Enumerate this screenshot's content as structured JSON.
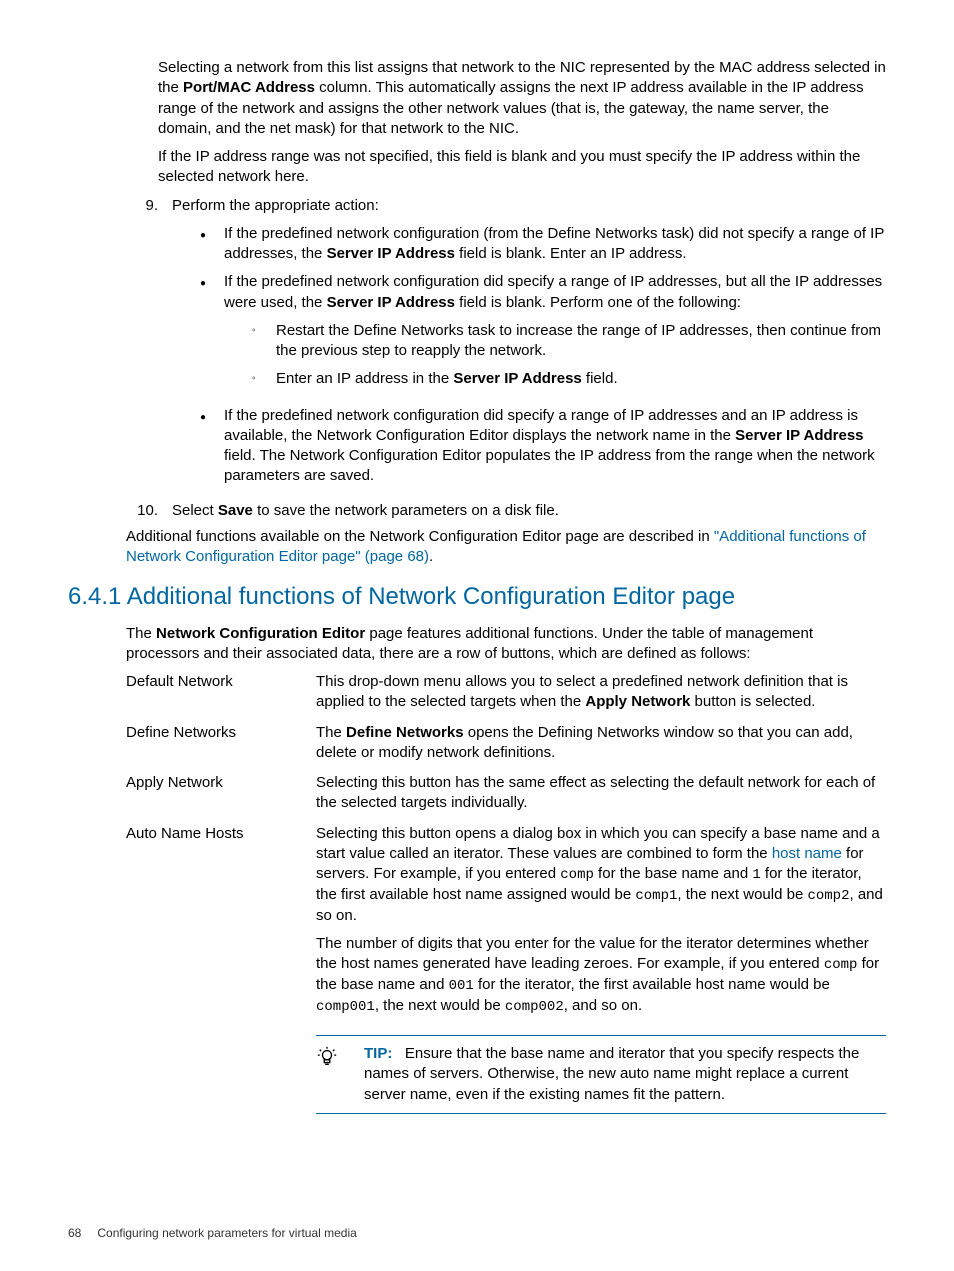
{
  "preamble": {
    "p1_a": "Selecting a network from this list assigns that network to the NIC represented by the MAC address selected in the ",
    "p1_bold": "Port/MAC Address",
    "p1_b": " column. This automatically assigns the next IP address available in the IP address range of the network and assigns the other network values (that is, the gateway, the name server, the domain, and the net mask) for that network to the NIC.",
    "p2": "If the IP address range was not specified, this field is blank and you must specify the IP address within the selected network here."
  },
  "step9": {
    "num": "9.",
    "text": "Perform the appropriate action:",
    "b1_a": "If the predefined network configuration (from the Define Networks task) did not specify a range of IP addresses, the ",
    "b1_bold": "Server IP Address",
    "b1_b": " field is blank. Enter an IP address.",
    "b2_a": "If the predefined network configuration did specify a range of IP addresses, but all the IP addresses were used, the ",
    "b2_bold": "Server IP Address",
    "b2_b": " field is blank. Perform one of the following:",
    "b2_s1": "Restart the Define Networks task to increase the range of IP addresses, then continue from the previous step to reapply the network.",
    "b2_s2_a": "Enter an IP address in the ",
    "b2_s2_bold": "Server IP Address",
    "b2_s2_b": " field.",
    "b3_a": "If the predefined network configuration did specify a range of IP addresses and an IP address is available, the Network Configuration Editor displays the network name in the ",
    "b3_bold": "Server IP Address",
    "b3_b": " field. The Network Configuration Editor populates the IP address from the range when the network parameters are saved."
  },
  "step10": {
    "num": "10.",
    "a": "Select ",
    "bold": "Save",
    "b": " to save the network parameters on a disk file."
  },
  "add_p_a": "Additional functions available on the Network Configuration Editor page are described in ",
  "add_link": "\"Additional functions of Network Configuration Editor page\" (page 68)",
  "add_p_b": ".",
  "section_title": "6.4.1 Additional functions of Network Configuration Editor page",
  "intro_a": "The ",
  "intro_bold": "Network Configuration Editor",
  "intro_b": " page features additional functions. Under the table of management processors and their associated data, there are a row of buttons, which are defined as follows:",
  "dl": {
    "default_term": "Default Network",
    "default_a": "This drop-down menu allows you to select a predefined network definition that is applied to the selected targets when the ",
    "default_bold": "Apply Network",
    "default_b": " button is selected.",
    "define_term": "Define Networks",
    "define_a": "The ",
    "define_bold": "Define Networks",
    "define_b": " opens the Defining Networks window so that you can add, delete or modify network definitions.",
    "apply_term": "Apply Network",
    "apply_def": "Selecting this button has the same effect as selecting the default network for each of the selected targets individually.",
    "auto_term": "Auto Name Hosts",
    "auto_p1_a": "Selecting this button opens a dialog box in which you can specify a base name and a start value called an iterator. These values are combined to form the ",
    "auto_p1_link": "host name",
    "auto_p1_b": " for servers. For example, if you entered ",
    "auto_p1_code1": "comp",
    "auto_p1_c": " for the base name and ",
    "auto_p1_code2": "1",
    "auto_p1_d": " for the iterator, the first available host name assigned would be ",
    "auto_p1_code3": "comp1",
    "auto_p1_e": ", the next would be ",
    "auto_p1_code4": "comp2",
    "auto_p1_f": ", and so on.",
    "auto_p2_a": "The number of digits that you enter for the value for the iterator determines whether the host names generated have leading zeroes. For example, if you entered ",
    "auto_p2_code1": "comp",
    "auto_p2_b": " for the base name and ",
    "auto_p2_code2": "001",
    "auto_p2_c": " for the iterator, the first available host name would be ",
    "auto_p2_code3": "comp001",
    "auto_p2_d": ", the next would be ",
    "auto_p2_code4": "comp002",
    "auto_p2_e": ", and so on."
  },
  "tip": {
    "label": "TIP:",
    "text": "Ensure that the base name and iterator that you specify respects the names of servers. Otherwise, the new auto name might replace a current server name, even if the existing names fit the pattern."
  },
  "footer": {
    "page": "68",
    "title": "Configuring network parameters for virtual media"
  }
}
